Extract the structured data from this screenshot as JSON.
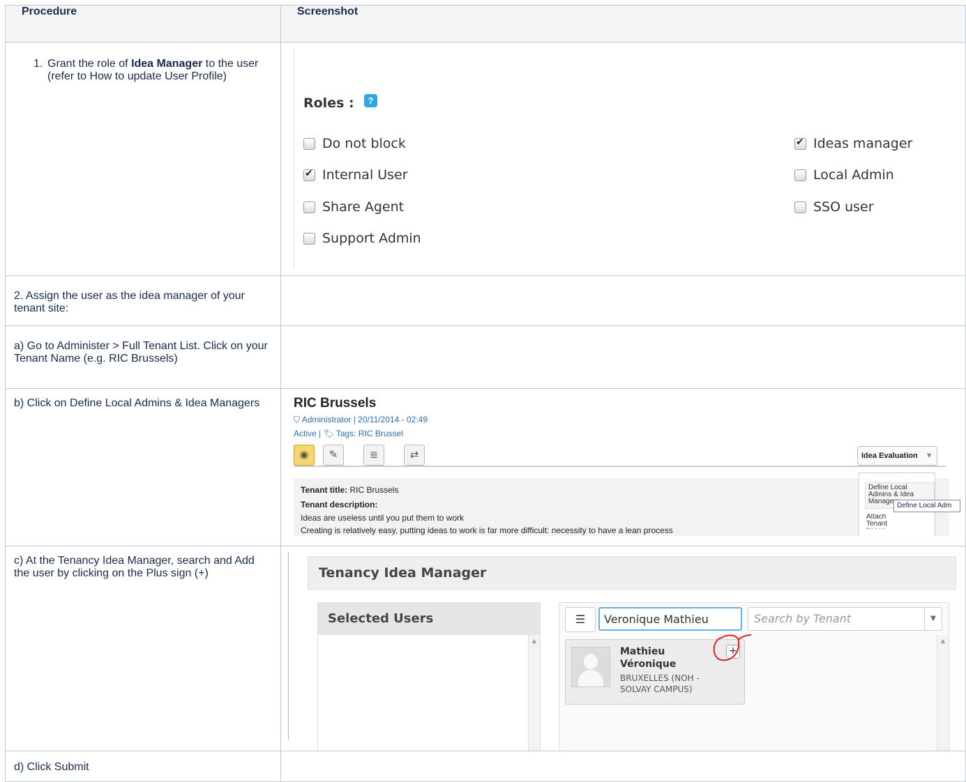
{
  "headers": {
    "procedure": "Procedure",
    "screenshot": "Screenshot"
  },
  "steps": {
    "s1_num": "1.",
    "s1_pre": "Grant the role of ",
    "s1_bold": "Idea Manager",
    "s1_post": " to the user (refer to How to update User Profile)",
    "s2": "2. Assign the user as the idea manager of your tenant site:",
    "sa": "a) Go to Administer > Full Tenant List. Click on your Tenant Name (e.g. RIC Brussels)",
    "sb": "b) Click on Define Local Admins & Idea Managers",
    "sc": "c) At the Tenancy Idea Manager, search and Add the user by clicking on the Plus sign (+)",
    "sd": "d) Click Submit"
  },
  "roles": {
    "title": "Roles :",
    "help_icon": "?",
    "items": [
      {
        "label": "Do not block",
        "checked": false
      },
      {
        "label": "Internal User",
        "checked": true
      },
      {
        "label": "Share Agent",
        "checked": false
      },
      {
        "label": "Support Admin",
        "checked": false
      },
      {
        "label": "Ideas manager",
        "checked": true
      },
      {
        "label": "Local Admin",
        "checked": false
      },
      {
        "label": "SSO user",
        "checked": false
      }
    ]
  },
  "ric": {
    "title": "RIC Brussels",
    "author": "Administrator",
    "date": "20/11/2014 - 02:49",
    "status": "Active |",
    "tags_label": "Tags:",
    "tags_value": "RIC Brussel",
    "idea_eval": "Idea Evaluation",
    "tenant_title_label": "Tenant title:",
    "tenant_title_value": "RIC Brussels",
    "desc_label": "Tenant description:",
    "desc_line1": "Ideas are useless until you put them to work",
    "desc_line2": "Creating is relatively easy, putting ideas to work is far more difficult: necessity to have a lean process",
    "menu_item1": "Define Local Admins & Idea Managers",
    "menu_item2": "Attach Tenant Image",
    "tooltip": "Define Local Adm"
  },
  "tenancy": {
    "title": "Tenancy Idea Manager",
    "selected_users": "Selected Users",
    "search_value": "Veronique Mathieu",
    "tenant_placeholder": "Search by Tenant",
    "user_last": "Mathieu",
    "user_first": "Véronique",
    "user_location": "BRUXELLES (NOH - SOLVAY CAMPUS)",
    "plus": "+"
  }
}
